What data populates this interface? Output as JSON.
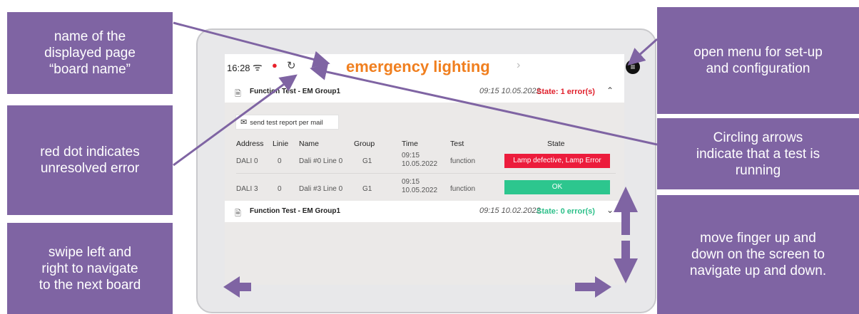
{
  "annotations": {
    "page_name": "name of the\ndisplayed page\n“board name”",
    "red_dot": "red dot indicates\nunresolved error",
    "swipe": "swipe left and\nright to navigate\nto the next board",
    "menu": "open menu for set-up\nand configuration",
    "circling": "Circling arrows\nindicate that a test is\nrunning",
    "scroll": "move finger up and\ndown on the screen to\nnavigate up and down."
  },
  "statusbar": {
    "time": "16:28",
    "board_name": "emergency lighting",
    "icons": [
      "wifi-icon",
      "red-dot-icon",
      "circling-arrows-icon",
      "chevron-right-icon",
      "menu-icon"
    ]
  },
  "sections": [
    {
      "title": "Function Test - EM Group1",
      "time": "09:15 10.05.2022",
      "state": "State: 1 error(s)",
      "state_color": "#e0202c"
    },
    {
      "title": "Function Test - EM Group1",
      "time": "09:15 10.02.2022",
      "state": "State: 0 error(s)",
      "state_color": "#2dc08a"
    }
  ],
  "mail_button": "send test report per mail",
  "table": {
    "headers": [
      "Address",
      "Linie",
      "Name",
      "Group",
      "Time",
      "Test",
      "State"
    ],
    "rows": [
      {
        "address": "DALI 0",
        "linie": "0",
        "name": "Dali #0 Line 0",
        "group": "G1",
        "time1": "09:15",
        "time2": "10.05.2022",
        "test": "function",
        "state": "Lamp defective, Lamp Error",
        "state_color": "#ec1c3c"
      },
      {
        "address": "DALI 3",
        "linie": "0",
        "name": "Dali #3 Line 0",
        "group": "G1",
        "time1": "09:15",
        "time2": "10.05.2022",
        "test": "function",
        "state": "OK",
        "state_color": "#2dc68e"
      }
    ]
  },
  "colors": {
    "annotation": "#7f64a3",
    "title": "#f07f1f"
  }
}
